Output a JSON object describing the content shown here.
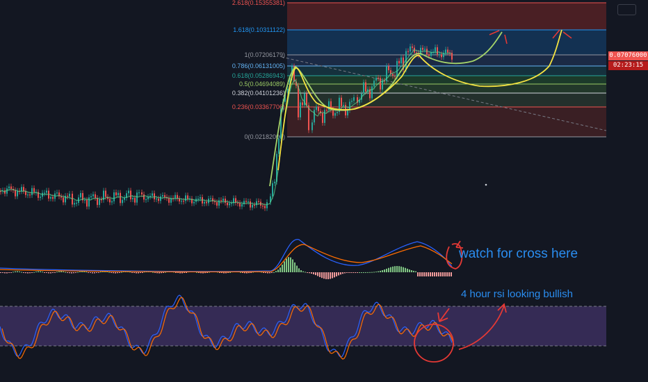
{
  "chart_data": {
    "type": "candlestick",
    "fib_levels": [
      {
        "label": "2.618(0.15355381)",
        "value": 0.15355381,
        "color": "#ef5350"
      },
      {
        "label": "1.618(0.10311122)",
        "value": 0.10311122,
        "color": "#2196f3"
      },
      {
        "label": "1(0.07206179)",
        "value": 0.07206179,
        "color": "#9598a1"
      },
      {
        "label": "0.786(0.06131005)",
        "value": 0.06131005,
        "color": "#64b5f6"
      },
      {
        "label": "0.618(0.05286943)",
        "value": 0.05286943,
        "color": "#26a69a"
      },
      {
        "label": "0.5(0.04694089)",
        "value": 0.04694089,
        "color": "#9ccc65"
      },
      {
        "label": "0.382(0.04101236)",
        "value": 0.04101236,
        "color": "#d1d4dc"
      },
      {
        "label": "0.236(0.03367706)",
        "value": 0.03367706,
        "color": "#ef5350"
      },
      {
        "label": "0(0.02182000)",
        "value": 0.02182,
        "color": "#9598a1"
      }
    ],
    "price_labels": [
      "0.07076000",
      "02:23:15"
    ],
    "annotations": [
      "watch for cross here",
      "4 hour rsi looking bullish"
    ]
  },
  "colors": {
    "background": "#131722",
    "up": "#26a69a",
    "down": "#ef5350",
    "rsi_band": "#7e57c2",
    "annotation_text": "#2a8df0",
    "marker_red": "#e53935",
    "projection_yellow": "#f5e342",
    "projection_green": "#a5d46a"
  },
  "icons": {
    "top_right": "chart-settings-icon"
  }
}
